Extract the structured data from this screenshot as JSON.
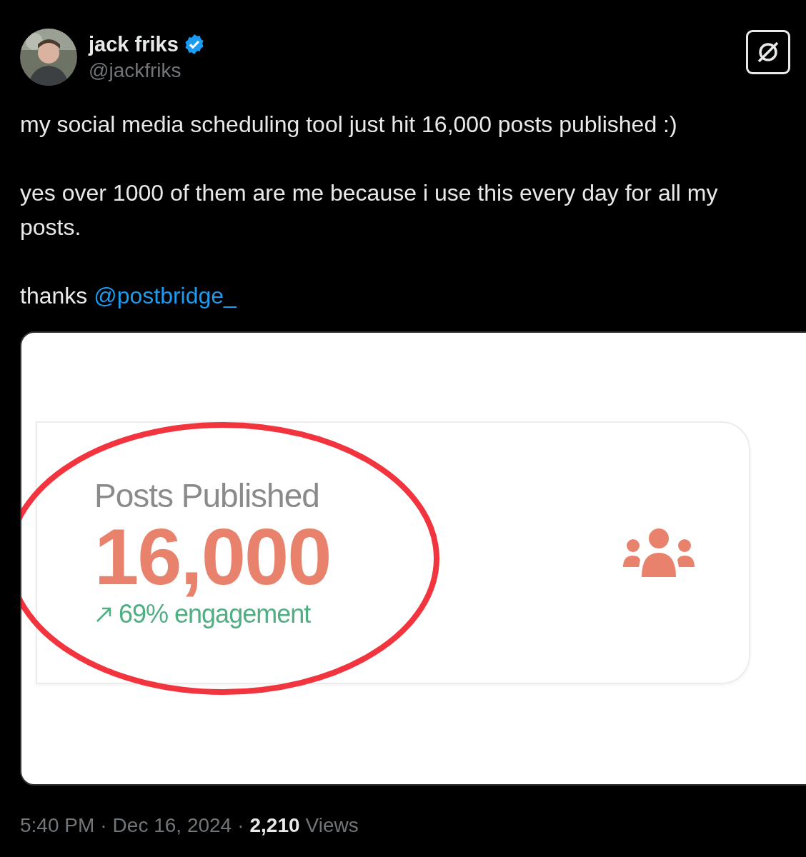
{
  "author": {
    "name": "jack friks",
    "verified": true,
    "handle": "@jackfriks"
  },
  "body": [
    {
      "text": "my social media scheduling tool just hit 16,000 posts published :)"
    },
    {
      "text": "yes over 1000 of them are me because i use this every day for all my posts."
    },
    {
      "text": "thanks",
      "mention": "@postbridge_"
    }
  ],
  "media": {
    "stat_card": {
      "label": "Posts Published",
      "value": "16,000",
      "trend": "69% engagement"
    },
    "circled": true
  },
  "footer": {
    "separator": "·",
    "time": "5:40 PM",
    "date": "Dec 16, 2024",
    "views_count": "2,210",
    "views_label": "Views"
  }
}
